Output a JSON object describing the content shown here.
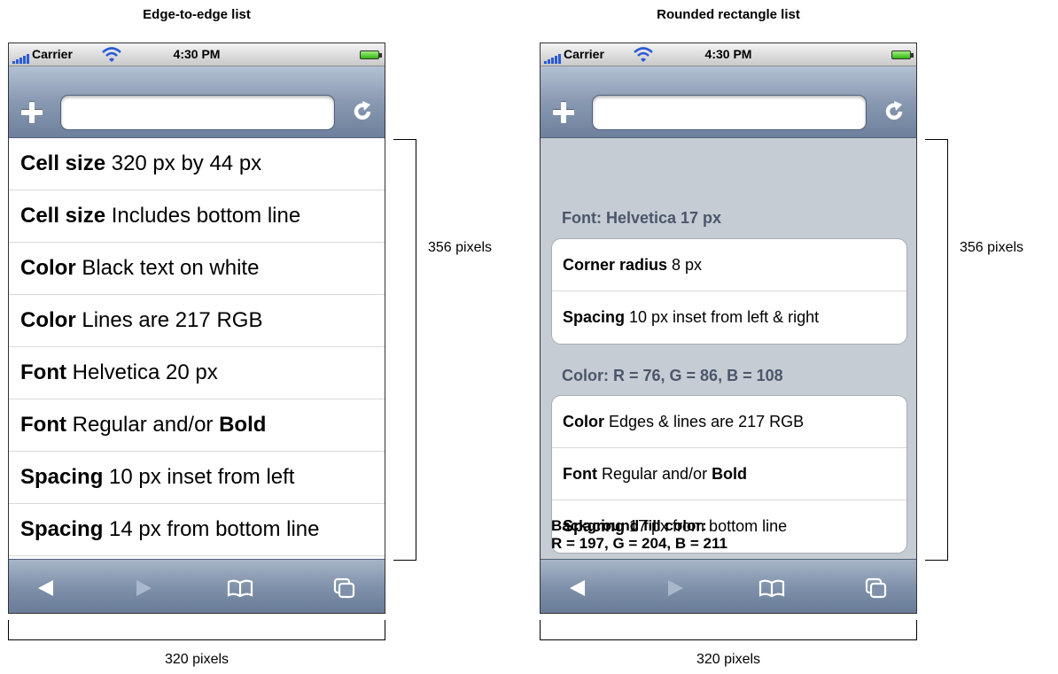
{
  "left": {
    "caption": "Edge-to-edge list",
    "status": {
      "carrier": "Carrier",
      "time": "4:30 PM"
    },
    "rows": [
      {
        "bold": "Cell size",
        "rest": " 320 px by 44 px"
      },
      {
        "bold": "Cell size",
        "rest": " Includes bottom line"
      },
      {
        "bold": "Color",
        "rest": " Black text on white"
      },
      {
        "bold": "Color",
        "rest": " Lines are 217 RGB"
      },
      {
        "bold": "Font",
        "rest": " Helvetica 20 px"
      },
      {
        "bold": "Font",
        "rest": " Regular and/or ",
        "bold2": "Bold"
      },
      {
        "bold": "Spacing",
        "rest": " 10 px inset from left"
      },
      {
        "bold": "Spacing",
        "rest": " 14 px from bottom line"
      }
    ],
    "height_label": "356 pixels",
    "width_label": "320 pixels"
  },
  "right": {
    "caption": "Rounded rectangle list",
    "status": {
      "carrier": "Carrier",
      "time": "4:30 PM"
    },
    "group1_header": "Font: Helvetica 17 px",
    "group1": [
      {
        "bold": "Corner radius",
        "rest": " 8 px"
      },
      {
        "bold": "Spacing",
        "rest": " 10 px inset from left & right"
      }
    ],
    "group2_header": "Color: R = 76, G = 86, B = 108",
    "group2": [
      {
        "bold": "Color",
        "rest": "  Edges & lines are 217 RGB"
      },
      {
        "bold": "Font",
        "rest": "  Regular and/or ",
        "bold2": "Bold"
      },
      {
        "bold": "Spacing",
        "rest": " 17 px from bottom line"
      }
    ],
    "background_note": {
      "line1": "Background fill color:",
      "line2": "R = 197, G = 204, B = 211"
    },
    "height_label": "356 pixels",
    "width_label": "320 pixels"
  },
  "colors": {
    "grouped_background": "#c5ccd3",
    "group_header_text": "#4c566c",
    "separator": "#d9d9d9",
    "toolbar": "#7f91aa"
  },
  "icons": {
    "toolbar": [
      "add-icon",
      "reload-icon"
    ],
    "tabbar": [
      "back-arrow-icon",
      "forward-arrow-icon",
      "bookmarks-icon",
      "pages-icon"
    ]
  }
}
